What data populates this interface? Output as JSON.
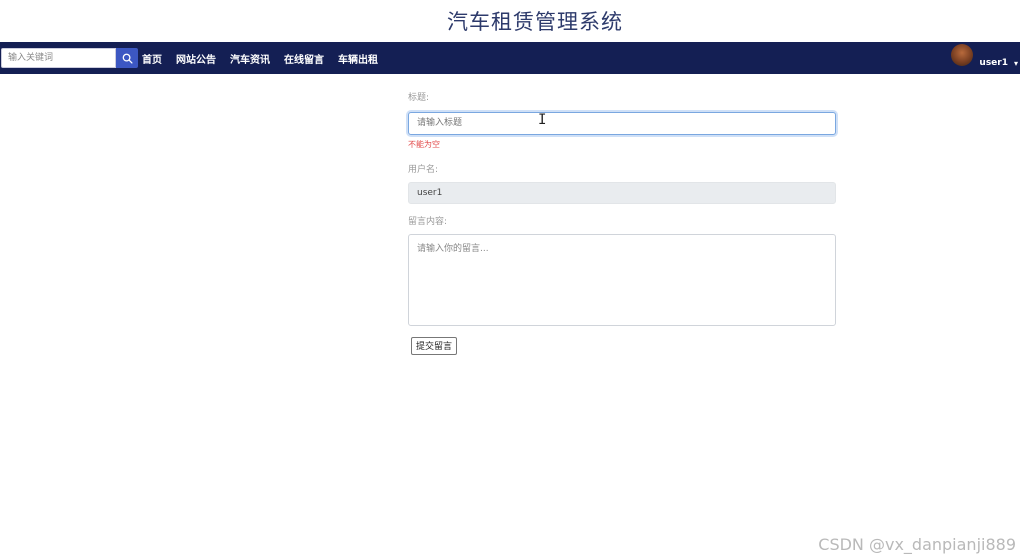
{
  "header": {
    "title": "汽车租赁管理系统"
  },
  "navbar": {
    "search": {
      "placeholder": "输入关键词",
      "icon": "search-icon"
    },
    "items": [
      {
        "label": "首页"
      },
      {
        "label": "网站公告"
      },
      {
        "label": "汽车资讯"
      },
      {
        "label": "在线留言"
      },
      {
        "label": "车辆出租"
      }
    ],
    "user": {
      "name": "user1",
      "caret": "▾",
      "avatar": "avatar"
    },
    "colors": {
      "background": "#141f54",
      "search_button": "#3c57c2"
    }
  },
  "form": {
    "title_label": "标题:",
    "title_placeholder": "请输入标题",
    "title_error": "不能为空",
    "username_label": "用户名:",
    "username_value": "user1",
    "message_label": "留言内容:",
    "message_placeholder": "请输入你的留言...",
    "submit_label": "提交留言"
  },
  "watermark": "CSDN @vx_danpianji889"
}
